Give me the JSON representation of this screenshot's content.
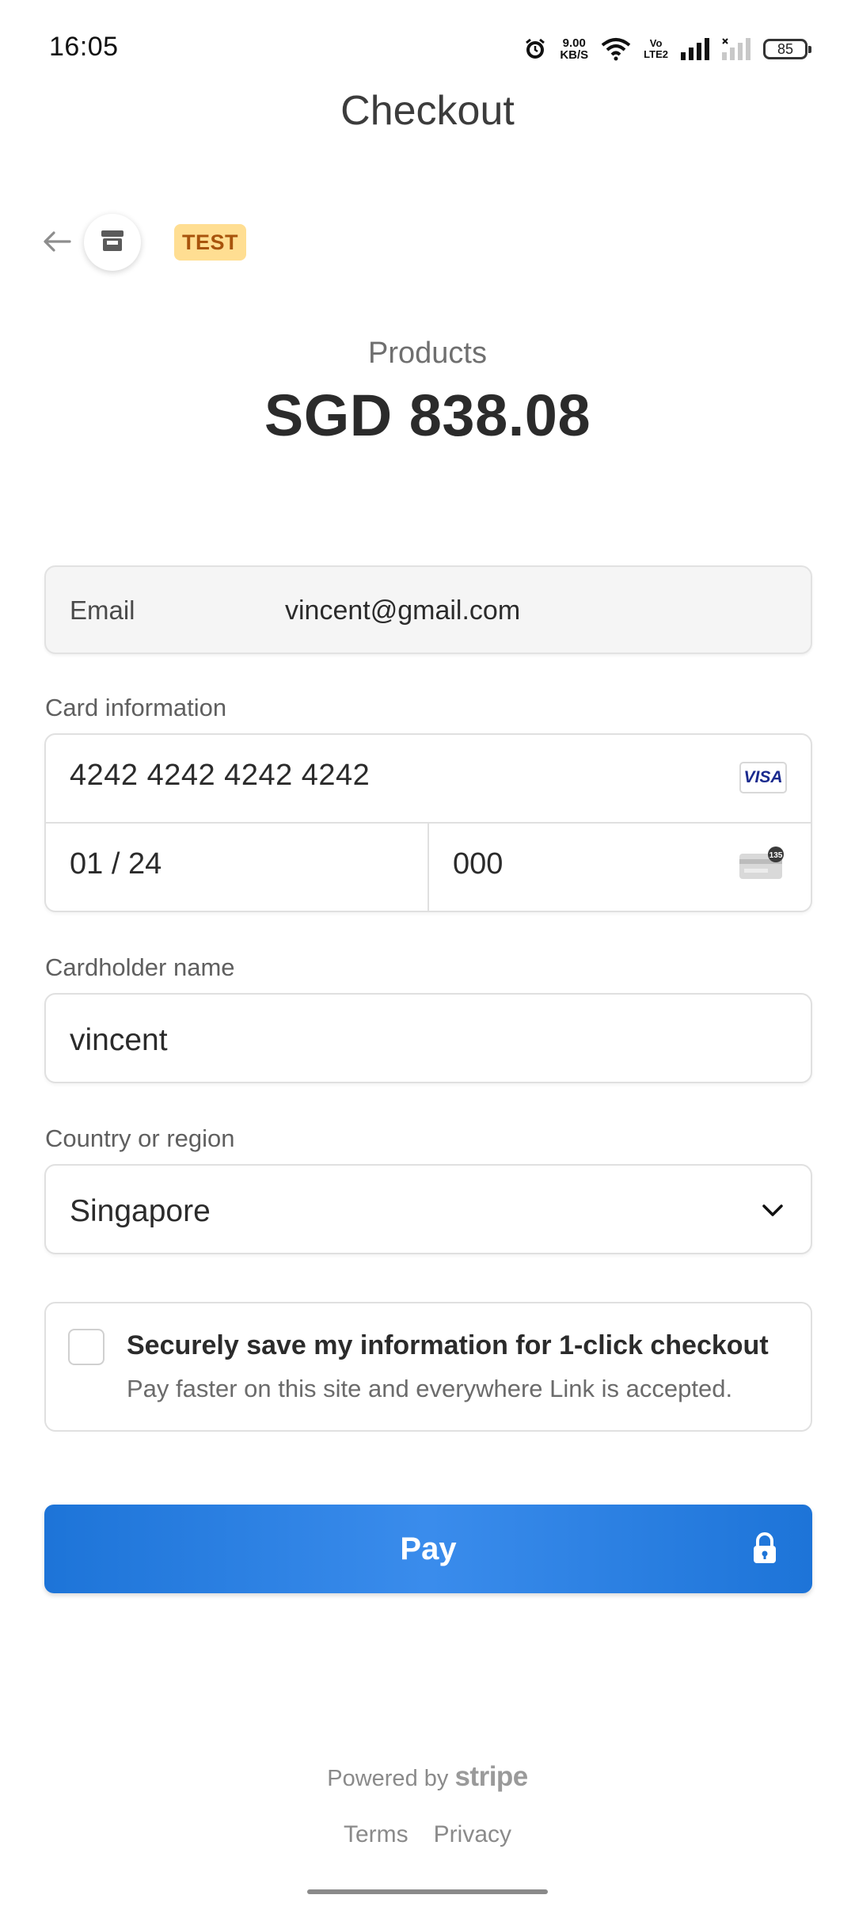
{
  "status_bar": {
    "time": "16:05",
    "net_speed_value": "9.00",
    "net_speed_unit": "KB/S",
    "volte_top": "Vo",
    "volte_bottom": "LTE2",
    "battery_level": "85"
  },
  "app_title": "Checkout",
  "header": {
    "badge_label": "TEST",
    "icons": {
      "back": "arrow-left-icon",
      "store": "store-icon"
    }
  },
  "summary": {
    "product_name": "Products",
    "amount": "SGD 838.08"
  },
  "email": {
    "label": "Email",
    "value": "vincent@gmail.com"
  },
  "card": {
    "label": "Card information",
    "number": "4242 4242 4242 4242",
    "brand": "VISA",
    "expiry": "01 / 24",
    "cvc": "000",
    "cvc_badge": "135"
  },
  "cardholder": {
    "label": "Cardholder name",
    "value": "vincent"
  },
  "country": {
    "label": "Country or region",
    "value": "Singapore"
  },
  "save_info": {
    "checked": false,
    "title": "Securely save my information for 1-click checkout",
    "subtitle": "Pay faster on this site and everywhere Link is accepted."
  },
  "pay_button": {
    "label": "Pay",
    "color": "#1d74d8"
  },
  "footer": {
    "powered_by": "Powered by",
    "brand": "stripe",
    "links": [
      "Terms",
      "Privacy"
    ]
  },
  "colors": {
    "test_badge_bg": "#ffde92",
    "test_badge_text": "#a8540c",
    "accent": "#1d74d8"
  }
}
